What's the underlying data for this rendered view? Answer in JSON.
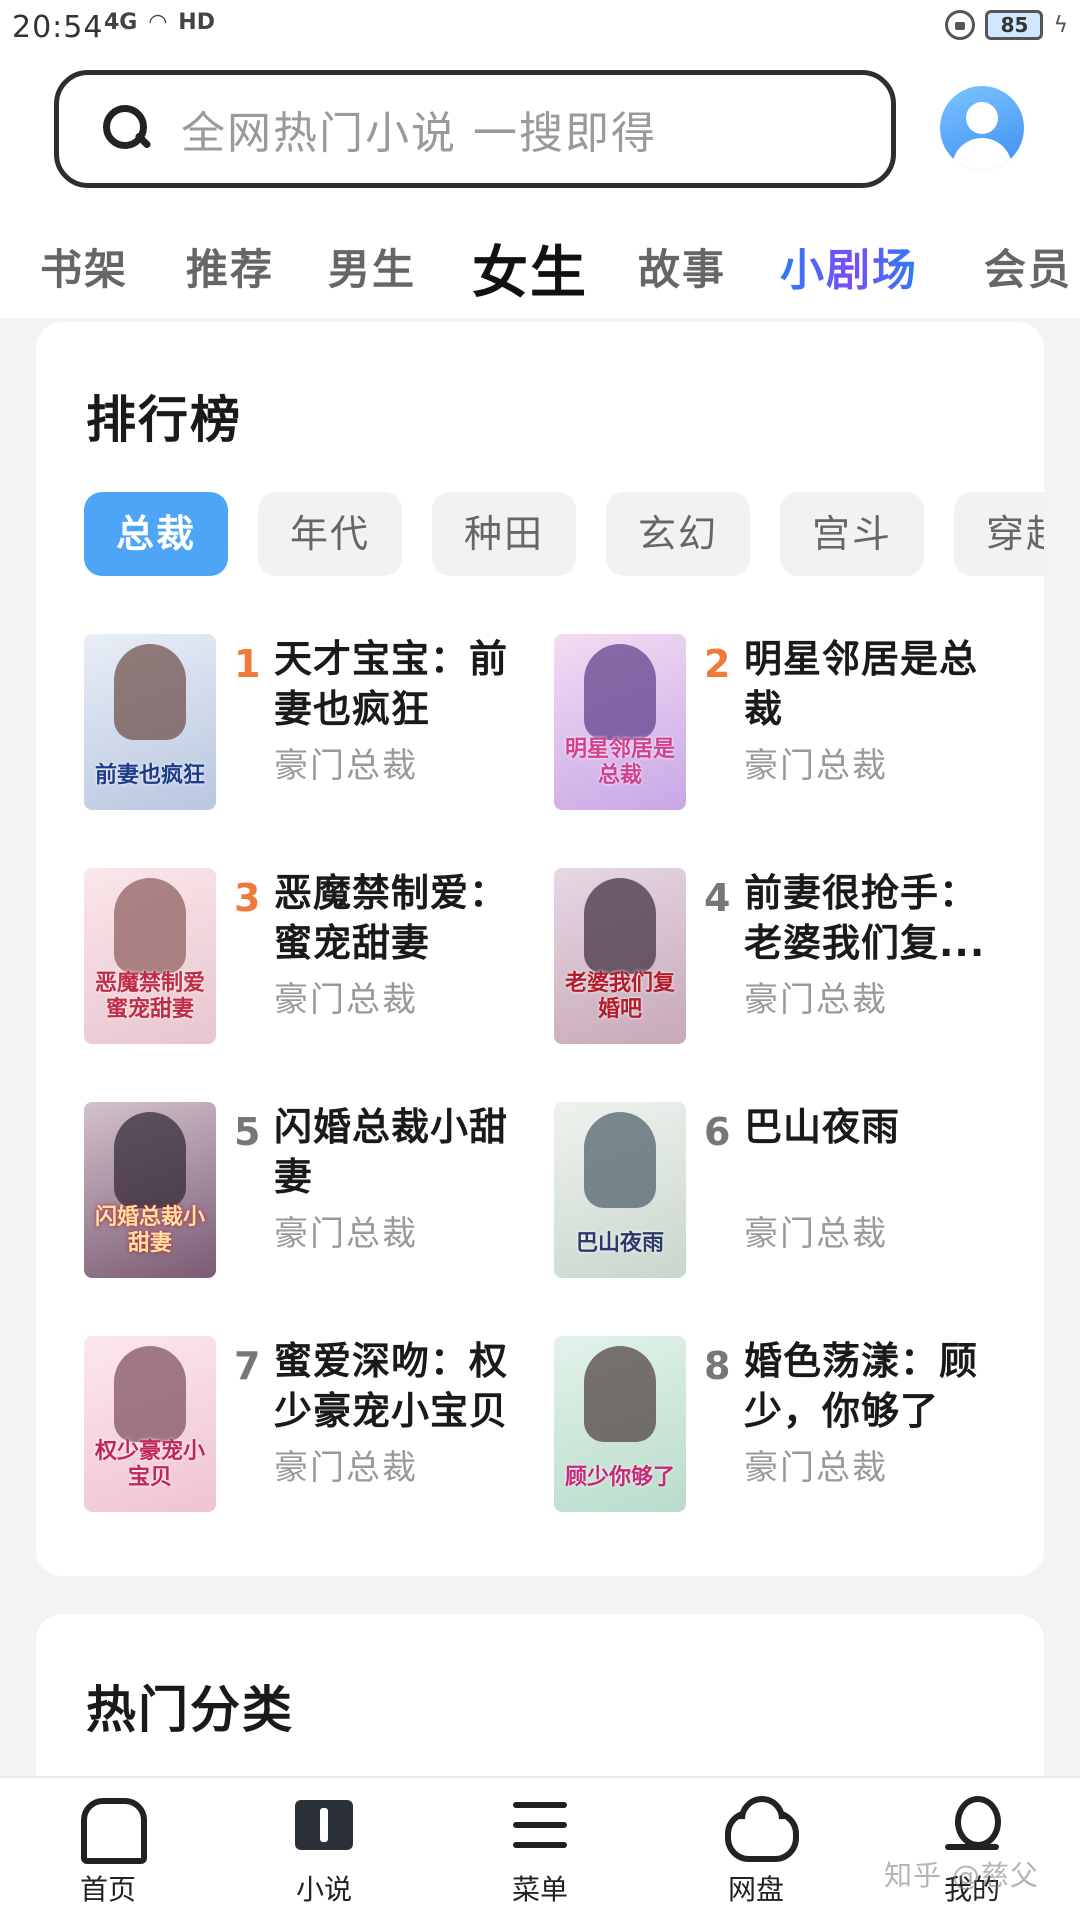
{
  "status_bar": {
    "time": "20:54",
    "network": "4G",
    "hd": "HD",
    "battery": "85"
  },
  "search": {
    "placeholder": "全网热门小说 一搜即得"
  },
  "nav_tabs": [
    {
      "label": "书架"
    },
    {
      "label": "推荐"
    },
    {
      "label": "男生"
    },
    {
      "label": "女生",
      "active": true
    },
    {
      "label": "故事"
    },
    {
      "label": "小剧场"
    },
    {
      "label": "会员"
    }
  ],
  "ranking": {
    "title": "排行榜",
    "chips": [
      "总裁",
      "年代",
      "种田",
      "玄幻",
      "宫斗",
      "穿越"
    ],
    "active_chip": "总裁",
    "books": [
      {
        "rank": "1",
        "title": "天才宝宝：前妻也疯狂",
        "tag": "豪门总裁",
        "cover_text": "前妻也疯狂"
      },
      {
        "rank": "2",
        "title": "明星邻居是总裁",
        "tag": "豪门总裁",
        "cover_text": "明星邻居是总裁"
      },
      {
        "rank": "3",
        "title": "恶魔禁制爱：蜜宠甜妻",
        "tag": "豪门总裁",
        "cover_text": "恶魔禁制爱蜜宠甜妻"
      },
      {
        "rank": "4",
        "title": "前妻很抢手：老婆我们复...",
        "tag": "豪门总裁",
        "cover_text": "老婆我们复婚吧"
      },
      {
        "rank": "5",
        "title": "闪婚总裁小甜妻",
        "tag": "豪门总裁",
        "cover_text": "闪婚总裁小甜妻"
      },
      {
        "rank": "6",
        "title": "巴山夜雨",
        "tag": "豪门总裁",
        "cover_text": "巴山夜雨"
      },
      {
        "rank": "7",
        "title": "蜜爱深吻：权少豪宠小宝贝",
        "tag": "豪门总裁",
        "cover_text": "权少豪宠小宝贝"
      },
      {
        "rank": "8",
        "title": "婚色荡漾：顾少，你够了",
        "tag": "豪门总裁",
        "cover_text": "顾少你够了"
      }
    ]
  },
  "hot_categories": {
    "title": "热门分类"
  },
  "bottom_nav": [
    {
      "label": "首页",
      "icon": "home-icon"
    },
    {
      "label": "小说",
      "icon": "book-icon"
    },
    {
      "label": "菜单",
      "icon": "menu-icon"
    },
    {
      "label": "网盘",
      "icon": "cloud-icon"
    },
    {
      "label": "我的",
      "icon": "user-icon"
    }
  ],
  "watermark": "知乎 @慈父",
  "colors": {
    "accent": "#4ea5f5",
    "rank_top": "#f07a3a",
    "rank_other": "#777777",
    "tag": "#999999"
  }
}
